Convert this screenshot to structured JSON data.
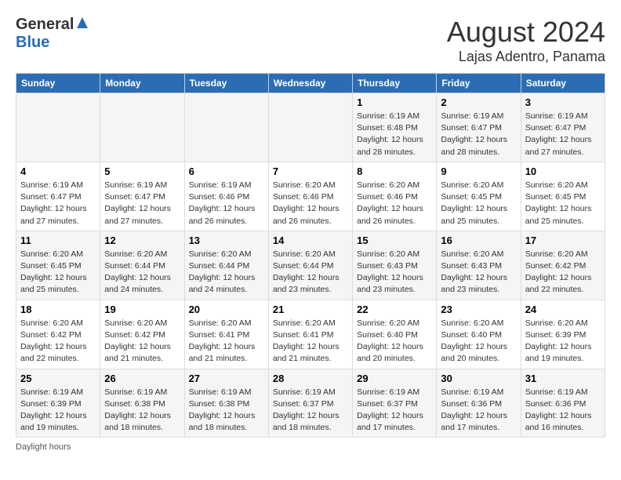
{
  "header": {
    "logo_general": "General",
    "logo_blue": "Blue",
    "month_title": "August 2024",
    "location": "Lajas Adentro, Panama"
  },
  "days_of_week": [
    "Sunday",
    "Monday",
    "Tuesday",
    "Wednesday",
    "Thursday",
    "Friday",
    "Saturday"
  ],
  "weeks": [
    [
      {
        "day": "",
        "info": ""
      },
      {
        "day": "",
        "info": ""
      },
      {
        "day": "",
        "info": ""
      },
      {
        "day": "",
        "info": ""
      },
      {
        "day": "1",
        "info": "Sunrise: 6:19 AM\nSunset: 6:48 PM\nDaylight: 12 hours and 28 minutes."
      },
      {
        "day": "2",
        "info": "Sunrise: 6:19 AM\nSunset: 6:47 PM\nDaylight: 12 hours and 28 minutes."
      },
      {
        "day": "3",
        "info": "Sunrise: 6:19 AM\nSunset: 6:47 PM\nDaylight: 12 hours and 27 minutes."
      }
    ],
    [
      {
        "day": "4",
        "info": "Sunrise: 6:19 AM\nSunset: 6:47 PM\nDaylight: 12 hours and 27 minutes."
      },
      {
        "day": "5",
        "info": "Sunrise: 6:19 AM\nSunset: 6:47 PM\nDaylight: 12 hours and 27 minutes."
      },
      {
        "day": "6",
        "info": "Sunrise: 6:19 AM\nSunset: 6:46 PM\nDaylight: 12 hours and 26 minutes."
      },
      {
        "day": "7",
        "info": "Sunrise: 6:20 AM\nSunset: 6:46 PM\nDaylight: 12 hours and 26 minutes."
      },
      {
        "day": "8",
        "info": "Sunrise: 6:20 AM\nSunset: 6:46 PM\nDaylight: 12 hours and 26 minutes."
      },
      {
        "day": "9",
        "info": "Sunrise: 6:20 AM\nSunset: 6:45 PM\nDaylight: 12 hours and 25 minutes."
      },
      {
        "day": "10",
        "info": "Sunrise: 6:20 AM\nSunset: 6:45 PM\nDaylight: 12 hours and 25 minutes."
      }
    ],
    [
      {
        "day": "11",
        "info": "Sunrise: 6:20 AM\nSunset: 6:45 PM\nDaylight: 12 hours and 25 minutes."
      },
      {
        "day": "12",
        "info": "Sunrise: 6:20 AM\nSunset: 6:44 PM\nDaylight: 12 hours and 24 minutes."
      },
      {
        "day": "13",
        "info": "Sunrise: 6:20 AM\nSunset: 6:44 PM\nDaylight: 12 hours and 24 minutes."
      },
      {
        "day": "14",
        "info": "Sunrise: 6:20 AM\nSunset: 6:44 PM\nDaylight: 12 hours and 23 minutes."
      },
      {
        "day": "15",
        "info": "Sunrise: 6:20 AM\nSunset: 6:43 PM\nDaylight: 12 hours and 23 minutes."
      },
      {
        "day": "16",
        "info": "Sunrise: 6:20 AM\nSunset: 6:43 PM\nDaylight: 12 hours and 23 minutes."
      },
      {
        "day": "17",
        "info": "Sunrise: 6:20 AM\nSunset: 6:42 PM\nDaylight: 12 hours and 22 minutes."
      }
    ],
    [
      {
        "day": "18",
        "info": "Sunrise: 6:20 AM\nSunset: 6:42 PM\nDaylight: 12 hours and 22 minutes."
      },
      {
        "day": "19",
        "info": "Sunrise: 6:20 AM\nSunset: 6:42 PM\nDaylight: 12 hours and 21 minutes."
      },
      {
        "day": "20",
        "info": "Sunrise: 6:20 AM\nSunset: 6:41 PM\nDaylight: 12 hours and 21 minutes."
      },
      {
        "day": "21",
        "info": "Sunrise: 6:20 AM\nSunset: 6:41 PM\nDaylight: 12 hours and 21 minutes."
      },
      {
        "day": "22",
        "info": "Sunrise: 6:20 AM\nSunset: 6:40 PM\nDaylight: 12 hours and 20 minutes."
      },
      {
        "day": "23",
        "info": "Sunrise: 6:20 AM\nSunset: 6:40 PM\nDaylight: 12 hours and 20 minutes."
      },
      {
        "day": "24",
        "info": "Sunrise: 6:20 AM\nSunset: 6:39 PM\nDaylight: 12 hours and 19 minutes."
      }
    ],
    [
      {
        "day": "25",
        "info": "Sunrise: 6:19 AM\nSunset: 6:39 PM\nDaylight: 12 hours and 19 minutes."
      },
      {
        "day": "26",
        "info": "Sunrise: 6:19 AM\nSunset: 6:38 PM\nDaylight: 12 hours and 18 minutes."
      },
      {
        "day": "27",
        "info": "Sunrise: 6:19 AM\nSunset: 6:38 PM\nDaylight: 12 hours and 18 minutes."
      },
      {
        "day": "28",
        "info": "Sunrise: 6:19 AM\nSunset: 6:37 PM\nDaylight: 12 hours and 18 minutes."
      },
      {
        "day": "29",
        "info": "Sunrise: 6:19 AM\nSunset: 6:37 PM\nDaylight: 12 hours and 17 minutes."
      },
      {
        "day": "30",
        "info": "Sunrise: 6:19 AM\nSunset: 6:36 PM\nDaylight: 12 hours and 17 minutes."
      },
      {
        "day": "31",
        "info": "Sunrise: 6:19 AM\nSunset: 6:36 PM\nDaylight: 12 hours and 16 minutes."
      }
    ]
  ],
  "footer": "Daylight hours"
}
